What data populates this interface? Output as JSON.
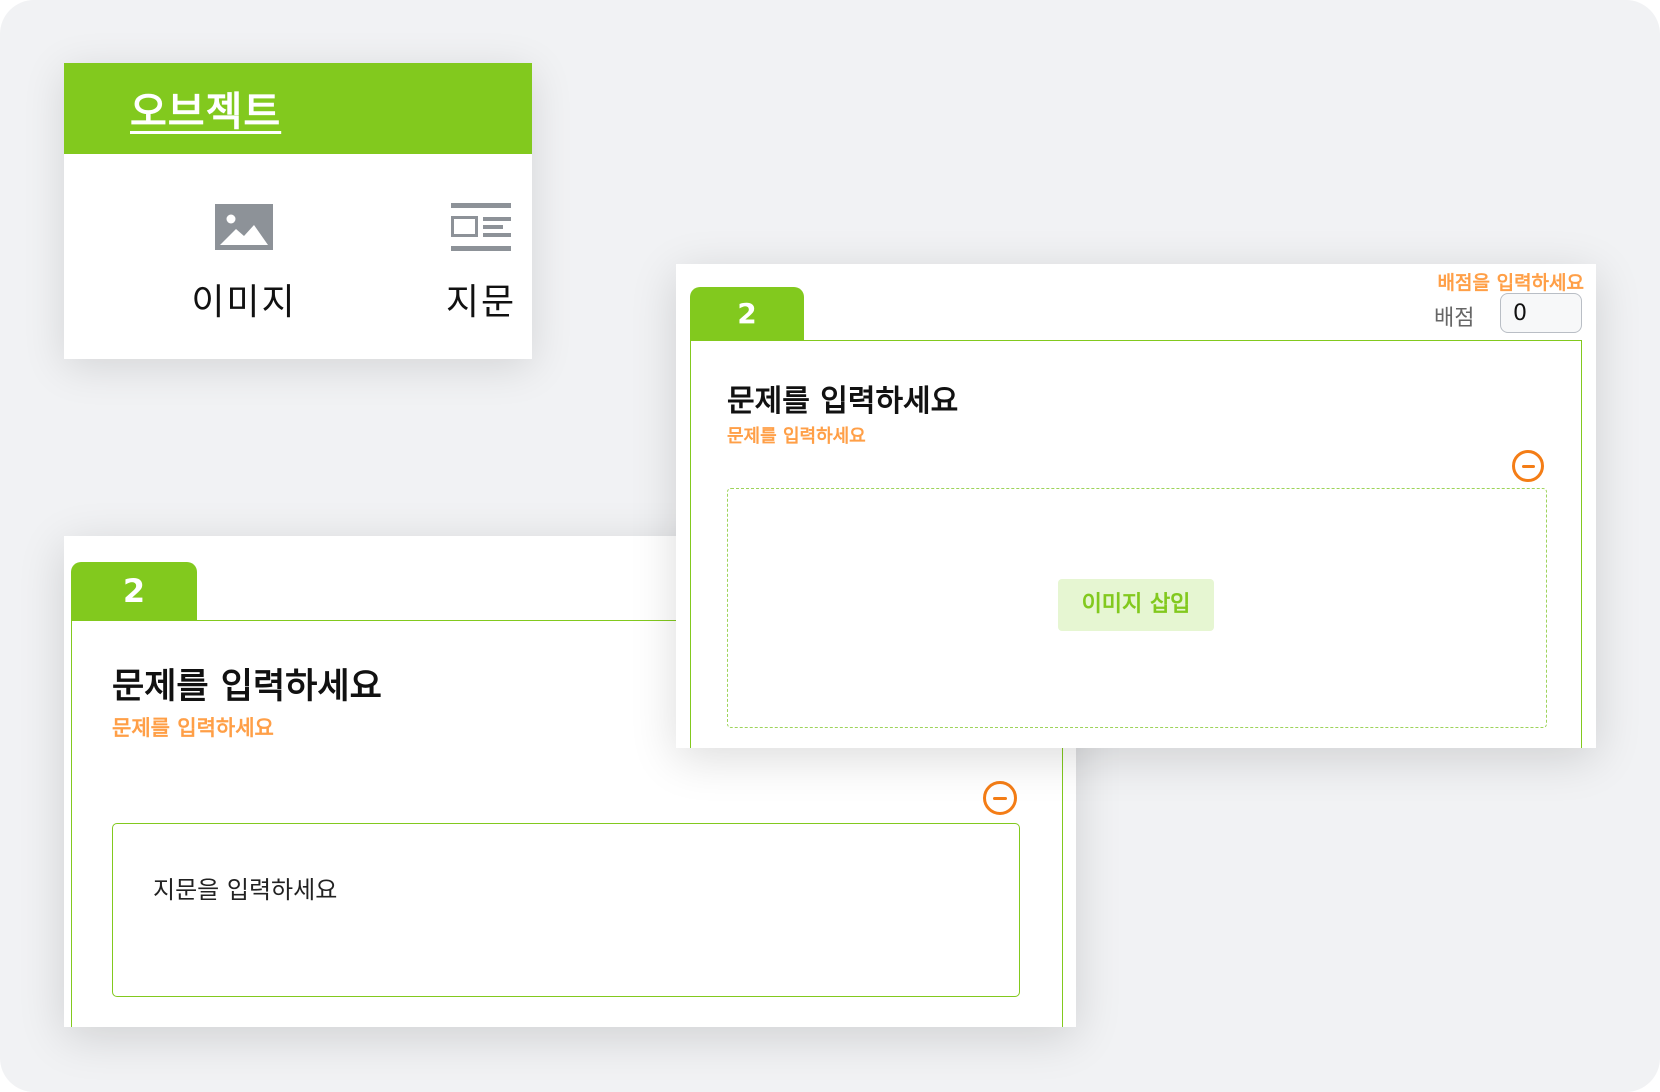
{
  "objects_panel": {
    "title": "오브젝트",
    "items": [
      {
        "label": "이미지",
        "icon": "image-icon"
      },
      {
        "label": "지문",
        "icon": "passage-icon"
      }
    ]
  },
  "question_passage": {
    "number": "2",
    "title": "문제를 입력하세요",
    "hint": "문제를 입력하세요",
    "passage_placeholder": "지문을 입력하세요"
  },
  "question_image": {
    "number": "2",
    "score_hint": "배점을 입력하세요",
    "score_label": "배점",
    "score_value": "0",
    "title": "문제를 입력하세요",
    "hint": "문제를 입력하세요",
    "insert_image_label": "이미지 삽입"
  },
  "colors": {
    "accent": "#82c91e",
    "hint": "#ff9f47",
    "remove": "#f47d16",
    "background": "#f1f2f4"
  }
}
